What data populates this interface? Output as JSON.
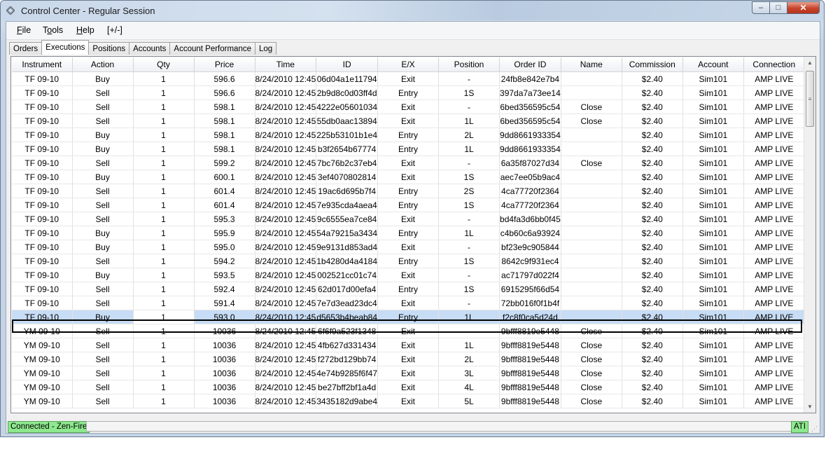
{
  "window": {
    "title": "Control Center - Regular Session",
    "minimize_glyph": "–",
    "maximize_glyph": "□",
    "close_glyph": "✕"
  },
  "menu": {
    "file": "File",
    "tools": "Tools",
    "help": "Help",
    "toggle": "[+/-]"
  },
  "tabs": [
    {
      "label": "Orders",
      "active": false
    },
    {
      "label": "Executions",
      "active": true
    },
    {
      "label": "Positions",
      "active": false
    },
    {
      "label": "Accounts",
      "active": false
    },
    {
      "label": "Account Performance",
      "active": false
    },
    {
      "label": "Log",
      "active": false
    }
  ],
  "grid": {
    "columns": [
      "Instrument",
      "Action",
      "Qty",
      "Price",
      "Time",
      "ID",
      "E/X",
      "Position",
      "Order ID",
      "Name",
      "Commission",
      "Account",
      "Connection"
    ],
    "selected_row": 17,
    "rows": [
      [
        "TF 09-10",
        "Buy",
        "1",
        "596.6",
        "8/24/2010 12:45",
        "06d04a1e11794",
        "Exit",
        "-",
        "24fb8e842e7b4",
        "",
        "$2.40",
        "Sim101",
        "AMP LIVE"
      ],
      [
        "TF 09-10",
        "Sell",
        "1",
        "596.6",
        "8/24/2010 12:45",
        "2b9d8c0d03ff4d",
        "Entry",
        "1S",
        "397da7a73ee14",
        "",
        "$2.40",
        "Sim101",
        "AMP LIVE"
      ],
      [
        "TF 09-10",
        "Sell",
        "1",
        "598.1",
        "8/24/2010 12:45",
        "4222e05601034",
        "Exit",
        "-",
        "6bed356595c54",
        "Close",
        "$2.40",
        "Sim101",
        "AMP LIVE"
      ],
      [
        "TF 09-10",
        "Sell",
        "1",
        "598.1",
        "8/24/2010 12:45",
        "55db0aac13894",
        "Exit",
        "1L",
        "6bed356595c54",
        "Close",
        "$2.40",
        "Sim101",
        "AMP LIVE"
      ],
      [
        "TF 09-10",
        "Buy",
        "1",
        "598.1",
        "8/24/2010 12:45",
        "225b53101b1e4",
        "Entry",
        "2L",
        "9dd8661933354",
        "",
        "$2.40",
        "Sim101",
        "AMP LIVE"
      ],
      [
        "TF 09-10",
        "Buy",
        "1",
        "598.1",
        "8/24/2010 12:45",
        "b3f2654b67774",
        "Entry",
        "1L",
        "9dd8661933354",
        "",
        "$2.40",
        "Sim101",
        "AMP LIVE"
      ],
      [
        "TF 09-10",
        "Sell",
        "1",
        "599.2",
        "8/24/2010 12:45",
        "7bc76b2c37eb4",
        "Exit",
        "-",
        "6a35f87027d34",
        "Close",
        "$2.40",
        "Sim101",
        "AMP LIVE"
      ],
      [
        "TF 09-10",
        "Buy",
        "1",
        "600.1",
        "8/24/2010 12:45",
        "3ef4070802814",
        "Exit",
        "1S",
        "aec7ee05b9ac4",
        "",
        "$2.40",
        "Sim101",
        "AMP LIVE"
      ],
      [
        "TF 09-10",
        "Sell",
        "1",
        "601.4",
        "8/24/2010 12:45",
        "19ac6d695b7f4",
        "Entry",
        "2S",
        "4ca77720f2364",
        "",
        "$2.40",
        "Sim101",
        "AMP LIVE"
      ],
      [
        "TF 09-10",
        "Sell",
        "1",
        "601.4",
        "8/24/2010 12:45",
        "7e935cda4aea4",
        "Entry",
        "1S",
        "4ca77720f2364",
        "",
        "$2.40",
        "Sim101",
        "AMP LIVE"
      ],
      [
        "TF 09-10",
        "Sell",
        "1",
        "595.3",
        "8/24/2010 12:45",
        "9c6555ea7ce84",
        "Exit",
        "-",
        "bd4fa3d6bb0f45",
        "",
        "$2.40",
        "Sim101",
        "AMP LIVE"
      ],
      [
        "TF 09-10",
        "Buy",
        "1",
        "595.9",
        "8/24/2010 12:45",
        "54a79215a3434",
        "Entry",
        "1L",
        "c4b60c6a93924",
        "",
        "$2.40",
        "Sim101",
        "AMP LIVE"
      ],
      [
        "TF 09-10",
        "Buy",
        "1",
        "595.0",
        "8/24/2010 12:45",
        "9e9131d853ad4",
        "Exit",
        "-",
        "bf23e9c905844",
        "",
        "$2.40",
        "Sim101",
        "AMP LIVE"
      ],
      [
        "TF 09-10",
        "Sell",
        "1",
        "594.2",
        "8/24/2010 12:45",
        "1b4280d4a4184",
        "Entry",
        "1S",
        "8642c9f931ec4",
        "",
        "$2.40",
        "Sim101",
        "AMP LIVE"
      ],
      [
        "TF 09-10",
        "Buy",
        "1",
        "593.5",
        "8/24/2010 12:45",
        "002521cc01c74",
        "Exit",
        "-",
        "ac71797d022f4",
        "",
        "$2.40",
        "Sim101",
        "AMP LIVE"
      ],
      [
        "TF 09-10",
        "Sell",
        "1",
        "592.4",
        "8/24/2010 12:45",
        "62d017d00efa4",
        "Entry",
        "1S",
        "6915295f66d54",
        "",
        "$2.40",
        "Sim101",
        "AMP LIVE"
      ],
      [
        "TF 09-10",
        "Sell",
        "1",
        "591.4",
        "8/24/2010 12:45",
        "7e7d3ead23dc4",
        "Exit",
        "-",
        "72bb016f0f1b4f",
        "",
        "$2.40",
        "Sim101",
        "AMP LIVE"
      ],
      [
        "TF 09-10",
        "Buy",
        "1",
        "593.0",
        "8/24/2010 12:45",
        "d5653b4beab84",
        "Entry",
        "1L",
        "f2c8f0ca5d24d",
        "",
        "$2.40",
        "Sim101",
        "AMP LIVE"
      ],
      [
        "YM 09-10",
        "Sell",
        "1",
        "10036",
        "8/24/2010 12:45",
        "6f6f9a523f1348",
        "Exit",
        "-",
        "9bfff8819e5448",
        "Close",
        "$2.40",
        "Sim101",
        "AMP LIVE"
      ],
      [
        "YM 09-10",
        "Sell",
        "1",
        "10036",
        "8/24/2010 12:45",
        "4fb627d331434",
        "Exit",
        "1L",
        "9bfff8819e5448",
        "Close",
        "$2.40",
        "Sim101",
        "AMP LIVE"
      ],
      [
        "YM 09-10",
        "Sell",
        "1",
        "10036",
        "8/24/2010 12:45",
        "f272bd129bb74",
        "Exit",
        "2L",
        "9bfff8819e5448",
        "Close",
        "$2.40",
        "Sim101",
        "AMP LIVE"
      ],
      [
        "YM 09-10",
        "Sell",
        "1",
        "10036",
        "8/24/2010 12:45",
        "4e74b9285f6f47",
        "Exit",
        "3L",
        "9bfff8819e5448",
        "Close",
        "$2.40",
        "Sim101",
        "AMP LIVE"
      ],
      [
        "YM 09-10",
        "Sell",
        "1",
        "10036",
        "8/24/2010 12:45",
        "be27bff2bf1a4d",
        "Exit",
        "4L",
        "9bfff8819e5448",
        "Close",
        "$2.40",
        "Sim101",
        "AMP LIVE"
      ],
      [
        "YM 09-10",
        "Sell",
        "1",
        "10036",
        "8/24/2010 12:45",
        "3435182d9abe4",
        "Exit",
        "5L",
        "9bfff8819e5448",
        "Close",
        "$2.40",
        "Sim101",
        "AMP LIVE"
      ]
    ]
  },
  "scrollbar": {
    "up_glyph": "▲",
    "down_glyph": "▼",
    "grip_glyph": "≡"
  },
  "status": {
    "connection": "Connected - Zen-Fire",
    "provider": "ATI",
    "connected_color": "#8ee88e"
  }
}
